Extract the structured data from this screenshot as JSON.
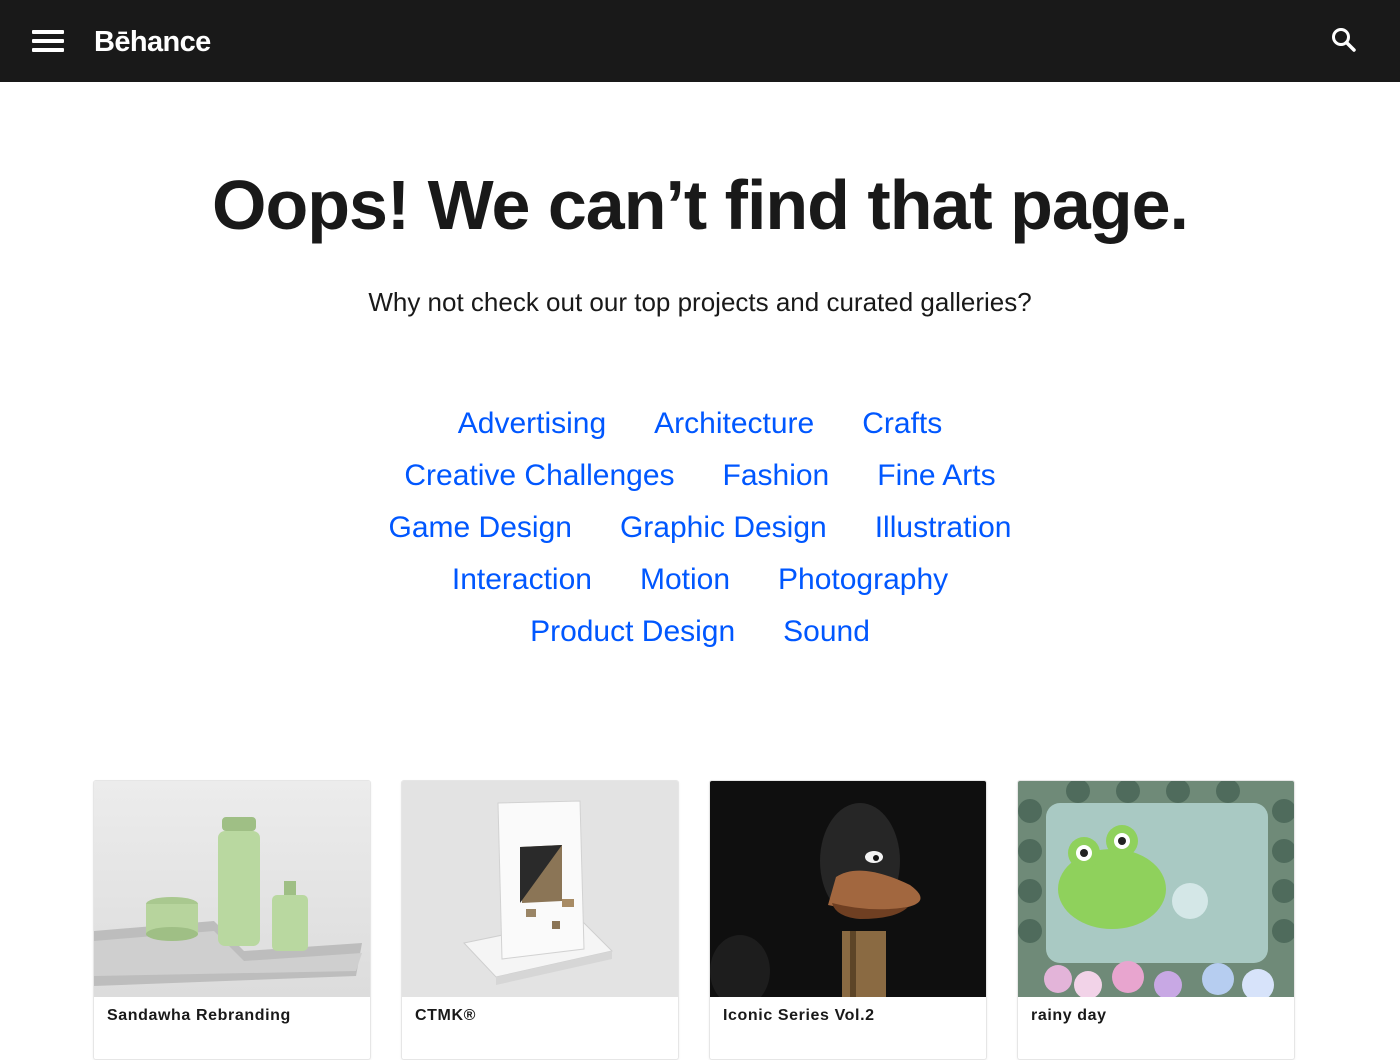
{
  "header": {
    "logo_text": "Bēhance",
    "menu_icon": "hamburger-menu-icon",
    "search_icon": "search-icon",
    "background": "#191919"
  },
  "main": {
    "headline": "Oops! We can’t find that page.",
    "subline": "Why not check out our top projects and curated galleries?",
    "link_color": "#0057ff",
    "categories": [
      [
        "Advertising",
        "Architecture",
        "Crafts"
      ],
      [
        "Creative Challenges",
        "Fashion",
        "Fine Arts"
      ],
      [
        "Game Design",
        "Graphic Design",
        "Illustration"
      ],
      [
        "Interaction",
        "Motion",
        "Photography"
      ],
      [
        "Product Design",
        "Sound"
      ]
    ]
  },
  "projects": [
    {
      "title": "Sandawha Rebranding"
    },
    {
      "title": "CTMK®"
    },
    {
      "title": "Iconic Series Vol.2"
    },
    {
      "title": "rainy day"
    }
  ]
}
